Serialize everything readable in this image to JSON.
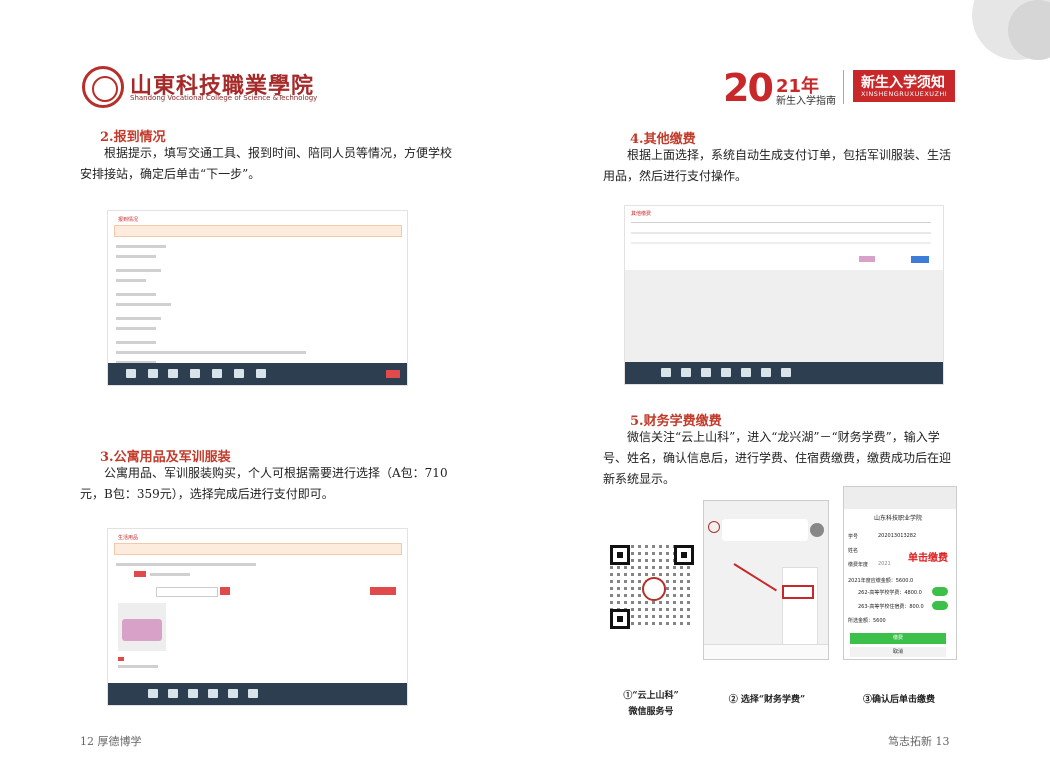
{
  "header": {
    "school_cn": "山東科技職業學院",
    "school_en": "Shandong Vocational College of Science &Technology",
    "year_big": "20",
    "year_small": "21年",
    "guide_sub": "新生入学指南",
    "badge_title": "新生入学须知",
    "badge_pinyin": "XINSHENGRUXUEXUZHI"
  },
  "left": {
    "s2_title": "2.报到情况",
    "s2_text": "根据提示，填写交通工具、报到时间、陪同人员等情况，方便学校安排接站，确定后单击“下一步”。",
    "s3_title": "3.公寓用品及军训服装",
    "s3_text": "公寓用品、军训服装购买，个人可根据需要进行选择（A包：710元，B包：359元），选择完成后进行支付即可。"
  },
  "right": {
    "s4_title": "4.其他缴费",
    "s4_text": "根据上面选择，系统自动生成支付订单，包括军训服装、生活用品，然后进行支付操作。",
    "s5_title": "5.财务学费缴费",
    "s5_text": "微信关注“云上山科”，进入“龙兴湖”－“财务学费”，输入学号、姓名，确认信息后，进行学费、住宿费缴费，缴费成功后在迎新系统显示。"
  },
  "phone2": {
    "school": "山东科技职业学院",
    "student_no_label": "学号",
    "student_no": "202013013282",
    "name_label": "姓名",
    "year_label": "缴费年度",
    "year": "2021",
    "annotation": "单击缴费",
    "total": "2021年度应缴金额：5600.0",
    "item1": "262-高等学校学费：4800.0",
    "item2": "263-高等学校住宿费：800.0",
    "selected": "所选金额：5600",
    "pay_btn": "缴费",
    "cancel_btn": "取消"
  },
  "captions": {
    "c1_line1": "①“云上山科”",
    "c1_line2": "微信服务号",
    "c2": "② 选择“财务学费”",
    "c3": "③确认后单击缴费"
  },
  "footer": {
    "left": "12 厚德博学",
    "right": "笃志拓新 13"
  },
  "colors": {
    "accent": "#c8282a",
    "section_title": "#c23a2a",
    "app_bar": "#2c3e50"
  }
}
